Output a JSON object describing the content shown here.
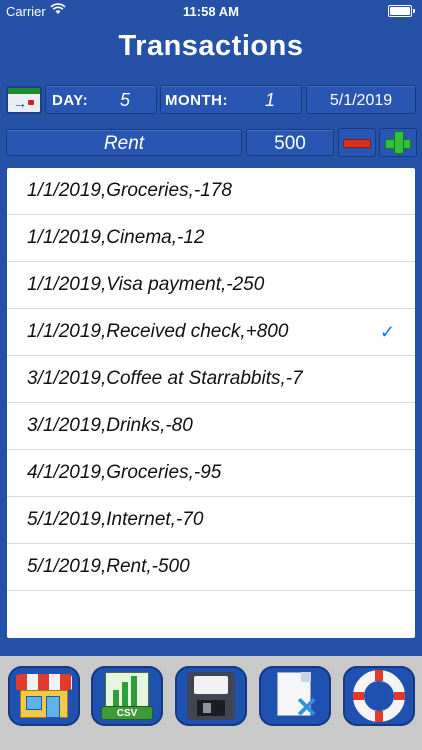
{
  "status_bar": {
    "carrier": "Carrier",
    "time": "11:58 AM"
  },
  "header": {
    "title": "Transactions"
  },
  "date_controls": {
    "day_label": "DAY:",
    "day_value": "5",
    "month_label": "MONTH:",
    "month_value": "1",
    "date_value": "5/1/2019"
  },
  "entry": {
    "description": "Rent",
    "amount": "500"
  },
  "transactions": [
    {
      "text": "1/1/2019,Groceries,-178",
      "checked": false
    },
    {
      "text": "1/1/2019,Cinema,-12",
      "checked": false
    },
    {
      "text": "1/1/2019,Visa payment,-250",
      "checked": false
    },
    {
      "text": "1/1/2019,Received check,+800",
      "checked": true
    },
    {
      "text": "3/1/2019,Coffee at Starrabbits,-7",
      "checked": false
    },
    {
      "text": "3/1/2019,Drinks,-80",
      "checked": false
    },
    {
      "text": "4/1/2019,Groceries,-95",
      "checked": false
    },
    {
      "text": "5/1/2019,Internet,-70",
      "checked": false
    },
    {
      "text": "5/1/2019,Rent,-500",
      "checked": false
    }
  ],
  "checkmark": "✓",
  "toolbar": {
    "csv_label": "CSV",
    "buttons": [
      "store-icon",
      "csv-icon",
      "floppy-disk-icon",
      "delete-file-icon",
      "lifebuoy-icon"
    ]
  },
  "colors": {
    "background": "#2552a6",
    "list_background": "#ffffff",
    "checkmark": "#1a73e8",
    "toolbar": "#c9c9c9"
  }
}
